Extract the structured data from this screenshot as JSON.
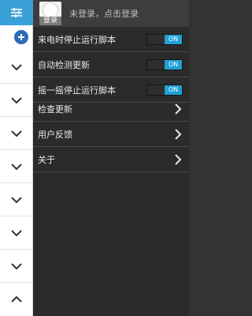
{
  "left_panel": {
    "chevrons": [
      "down",
      "down",
      "down",
      "down",
      "down",
      "down",
      "down",
      "up"
    ]
  },
  "drawer": {
    "avatar_label": "登录",
    "header_text": "未登录，点击登录",
    "toggles": [
      {
        "label": "来电时停止运行脚本",
        "state": "ON"
      },
      {
        "label": "自动检测更新",
        "state": "ON"
      },
      {
        "label": "摇一摇停止运行脚本",
        "state": "ON"
      }
    ],
    "links": [
      {
        "label": "检查更新"
      },
      {
        "label": "用户反馈"
      },
      {
        "label": "关于"
      }
    ]
  },
  "colors": {
    "accent": "#21a0d6",
    "top_left": "#3aa0d8",
    "drawer_bg": "#2b2b2b"
  }
}
